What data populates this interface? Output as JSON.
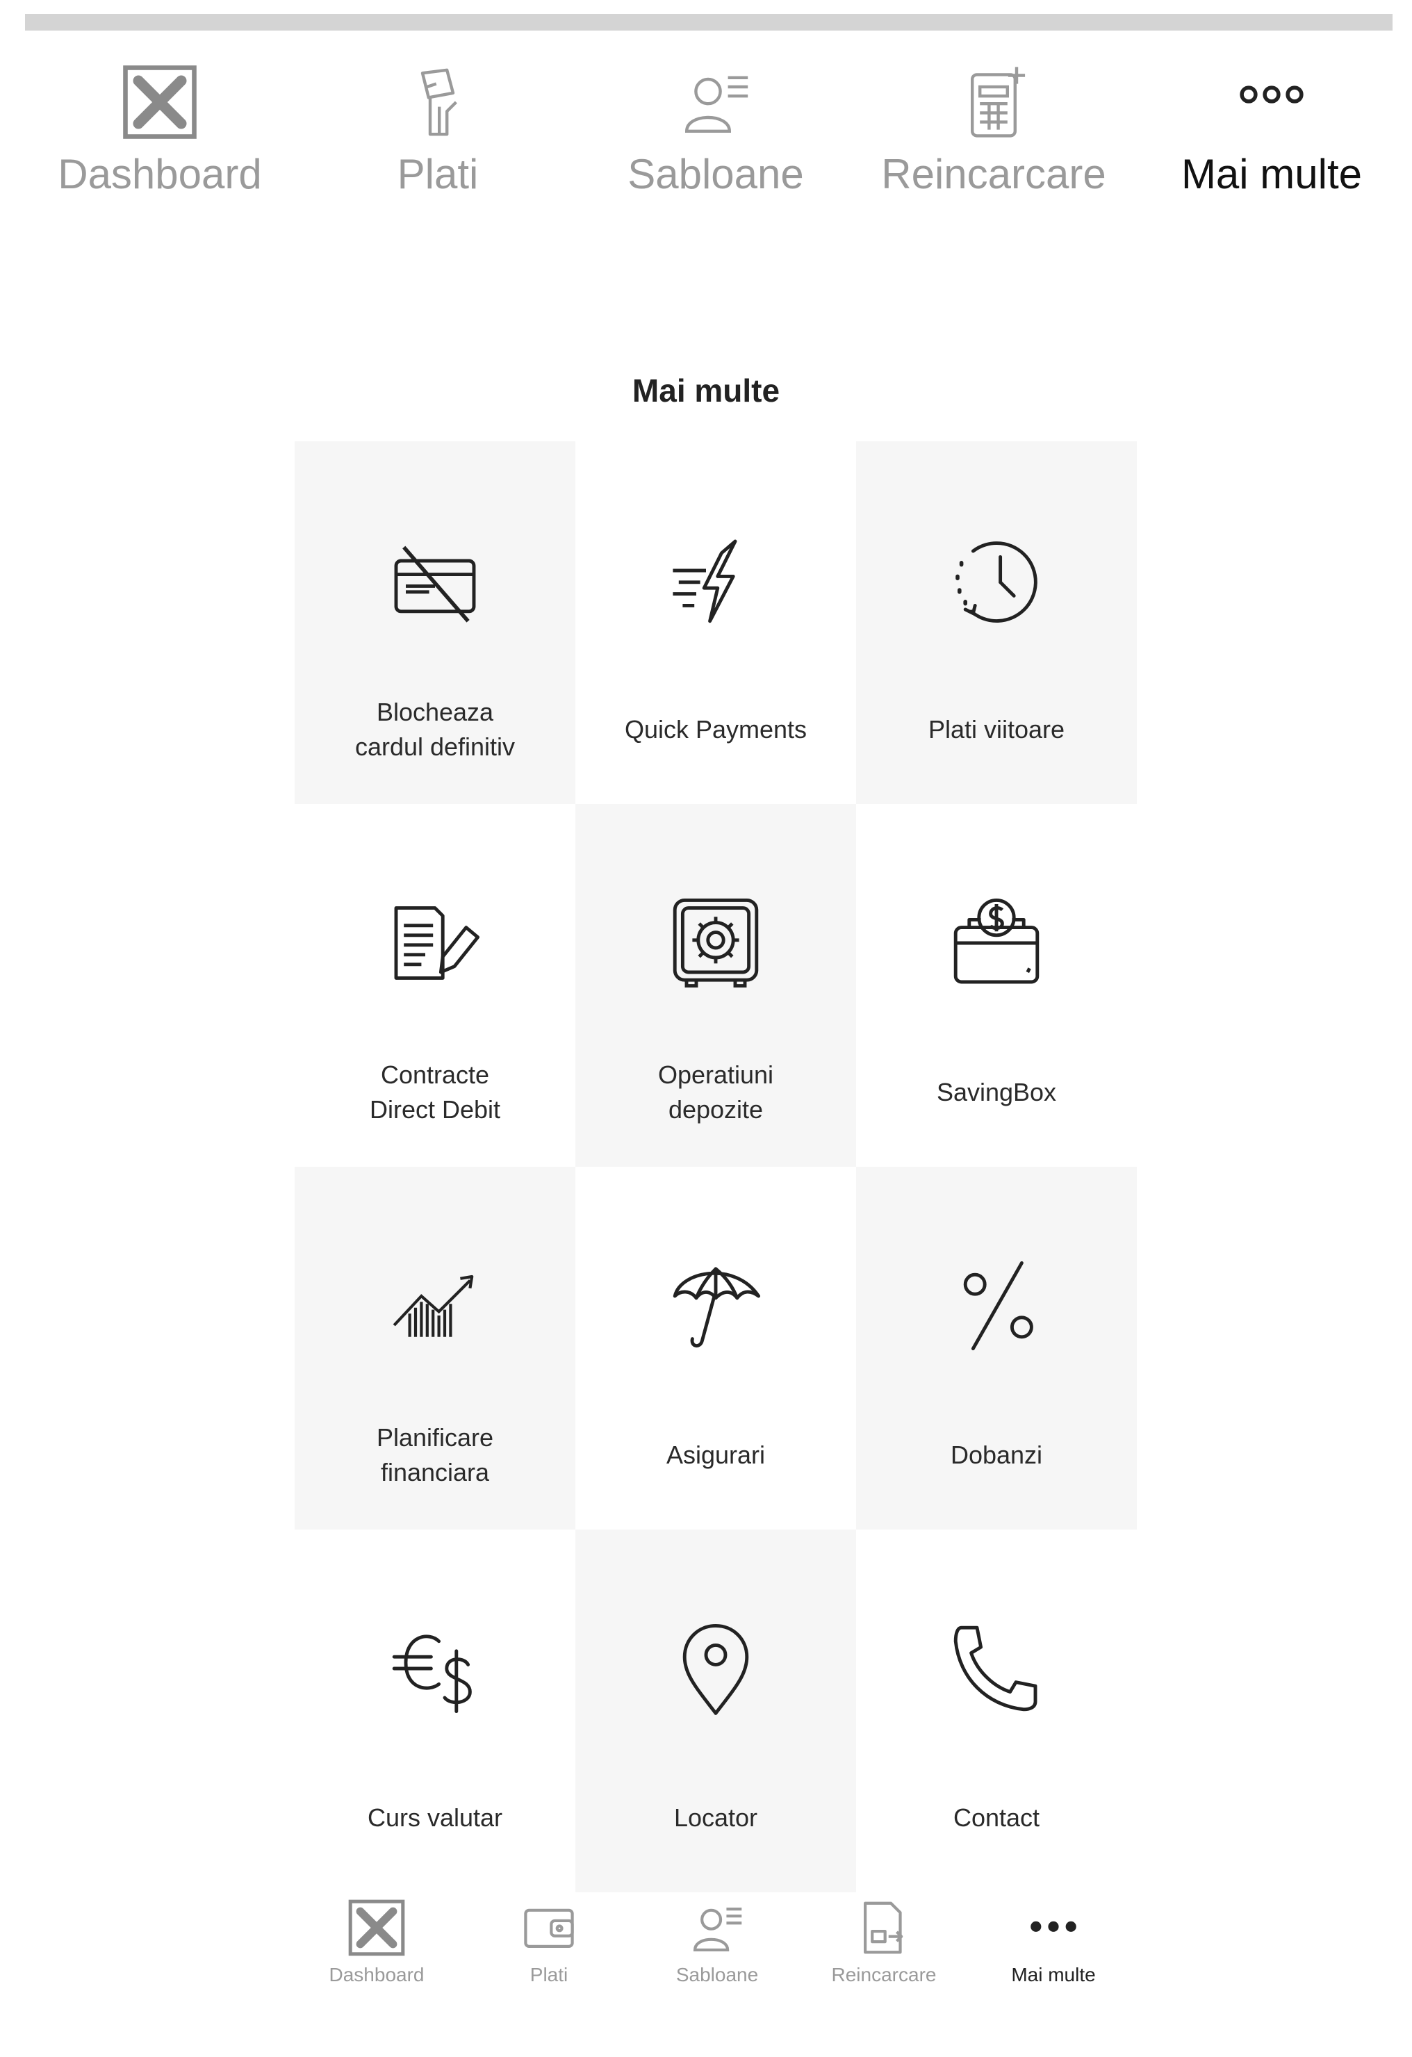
{
  "top_nav": {
    "items": [
      {
        "label": "Dashboard",
        "icon": "broken-image-icon"
      },
      {
        "label": "Plati",
        "icon": "payment-hand-icon"
      },
      {
        "label": "Sabloane",
        "icon": "templates-icon"
      },
      {
        "label": "Reincarcare",
        "icon": "top-up-icon"
      },
      {
        "label": "Mai multe",
        "icon": "more-dots-icon"
      }
    ],
    "active_index": 4
  },
  "page": {
    "title": "Mai multe"
  },
  "tiles": [
    {
      "label": "Blocheaza\ncardul definitiv",
      "icon": "card-blocked-icon"
    },
    {
      "label": "Quick Payments",
      "icon": "lightning-icon"
    },
    {
      "label": "Plati viitoare",
      "icon": "clock-icon"
    },
    {
      "label": "Contracte\nDirect Debit",
      "icon": "contract-pen-icon"
    },
    {
      "label": "Operatiuni\ndepozite",
      "icon": "safe-icon"
    },
    {
      "label": "SavingBox",
      "icon": "saving-box-icon"
    },
    {
      "label": "Planificare\nfinanciara",
      "icon": "growth-chart-icon"
    },
    {
      "label": "Asigurari",
      "icon": "umbrella-icon"
    },
    {
      "label": "Dobanzi",
      "icon": "percent-icon"
    },
    {
      "label": "Curs valutar",
      "icon": "currency-exchange-icon"
    },
    {
      "label": "Locator",
      "icon": "location-pin-icon"
    },
    {
      "label": "Contact",
      "icon": "phone-icon"
    }
  ],
  "bottom_nav": {
    "items": [
      {
        "label": "Dashboard",
        "icon": "broken-image-icon"
      },
      {
        "label": "Plati",
        "icon": "wallet-icon"
      },
      {
        "label": "Sabloane",
        "icon": "templates-icon"
      },
      {
        "label": "Reincarcare",
        "icon": "top-up-icon"
      },
      {
        "label": "Mai multe",
        "icon": "more-dots-icon"
      }
    ],
    "active_index": 4
  },
  "colors": {
    "tile_shade": "#f6f6f6",
    "inactive_text": "#9a9a9a",
    "active_text": "#111111",
    "scroll_strip": "#d4d4d4"
  }
}
